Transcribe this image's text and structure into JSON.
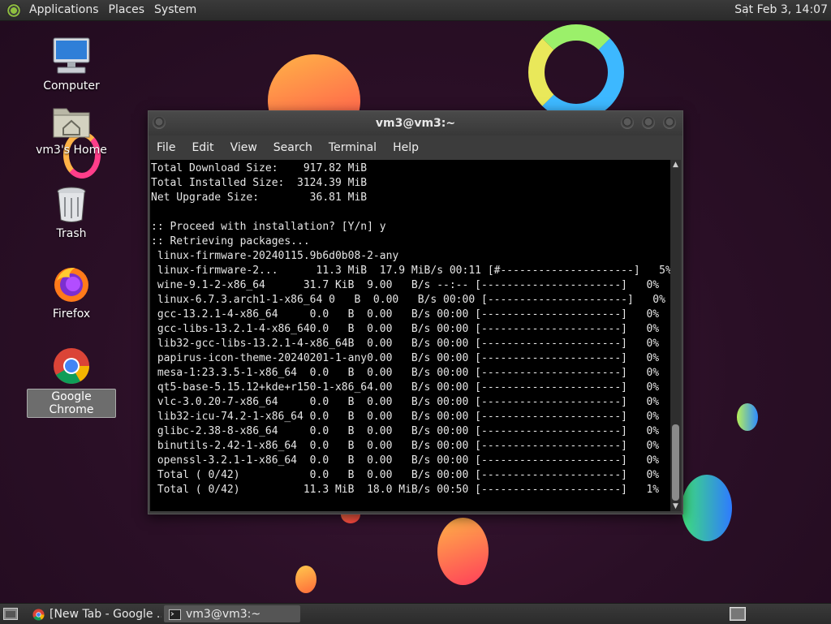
{
  "top_panel": {
    "menus": [
      "Applications",
      "Places",
      "System"
    ],
    "clock": "Sat Feb  3, 14:07"
  },
  "desktop_icons": [
    {
      "label": "Computer",
      "icon": "computer-icon"
    },
    {
      "label": "vm3's Home",
      "icon": "home-folder-icon"
    },
    {
      "label": "Trash",
      "icon": "trash-icon"
    },
    {
      "label": "Firefox",
      "icon": "firefox-icon"
    },
    {
      "label": "Google Chrome",
      "icon": "chrome-icon",
      "selected": true
    }
  ],
  "terminal": {
    "title": "vm3@vm3:~",
    "menu": [
      "File",
      "Edit",
      "View",
      "Search",
      "Terminal",
      "Help"
    ],
    "lines": [
      "Total Download Size:    917.82 MiB",
      "Total Installed Size:  3124.39 MiB",
      "Net Upgrade Size:        36.81 MiB",
      "",
      ":: Proceed with installation? [Y/n] y",
      ":: Retrieving packages...",
      " linux-firmware-20240115.9b6d0b08-2-any",
      " linux-firmware-2...      11.3 MiB  17.9 MiB/s 00:11 [#---------------------]   5%",
      " wine-9.1-2-x86_64      31.7 KiB  9.00   B/s --:-- [----------------------]   0%",
      " linux-6.7.3.arch1-1-x86_64 0   B  0.00   B/s 00:00 [----------------------]   0%",
      " gcc-13.2.1-4-x86_64     0.0   B  0.00   B/s 00:00 [----------------------]   0%",
      " gcc-libs-13.2.1-4-x86_640.0   B  0.00   B/s 00:00 [----------------------]   0%",
      " lib32-gcc-libs-13.2.1-4-x86_64B  0.00   B/s 00:00 [----------------------]   0%",
      " papirus-icon-theme-20240201-1-any0.00   B/s 00:00 [----------------------]   0%",
      " mesa-1:23.3.5-1-x86_64  0.0   B  0.00   B/s 00:00 [----------------------]   0%",
      " qt5-base-5.15.12+kde+r150-1-x86_64.00   B/s 00:00 [----------------------]   0%",
      " vlc-3.0.20-7-x86_64     0.0   B  0.00   B/s 00:00 [----------------------]   0%",
      " lib32-icu-74.2-1-x86_64 0.0   B  0.00   B/s 00:00 [----------------------]   0%",
      " glibc-2.38-8-x86_64     0.0   B  0.00   B/s 00:00 [----------------------]   0%",
      " binutils-2.42-1-x86_64  0.0   B  0.00   B/s 00:00 [----------------------]   0%",
      " openssl-3.2.1-1-x86_64  0.0   B  0.00   B/s 00:00 [----------------------]   0%",
      " Total ( 0/42)           0.0   B  0.00   B/s 00:00 [----------------------]   0%",
      " Total ( 0/42)          11.3 MiB  18.0 MiB/s 00:50 [----------------------]   1%"
    ]
  },
  "taskbar": {
    "tasks": [
      {
        "label": "[New Tab - Google ...",
        "icon": "chrome-icon",
        "active": false
      },
      {
        "label": "vm3@vm3:~",
        "icon": "terminal-icon",
        "active": true
      }
    ]
  }
}
